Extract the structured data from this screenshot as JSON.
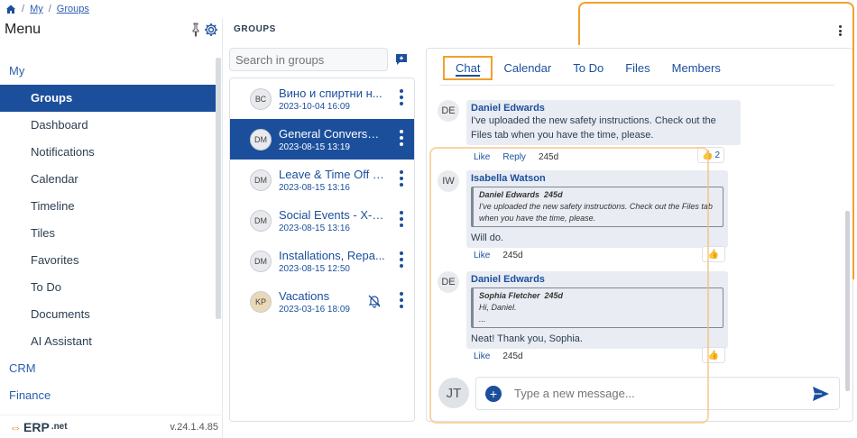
{
  "breadcrumb": {
    "items": [
      "My",
      "Groups"
    ]
  },
  "menu": {
    "title": "Menu",
    "sections": [
      {
        "label": "My"
      },
      {
        "label": "CRM"
      },
      {
        "label": "Finance"
      }
    ],
    "items": [
      {
        "label": "Groups"
      },
      {
        "label": "Dashboard"
      },
      {
        "label": "Notifications"
      },
      {
        "label": "Calendar"
      },
      {
        "label": "Timeline"
      },
      {
        "label": "Tiles"
      },
      {
        "label": "Favorites"
      },
      {
        "label": "To Do"
      },
      {
        "label": "Documents"
      },
      {
        "label": "AI Assistant"
      }
    ],
    "footer": {
      "logo_text": "ERP",
      "logo_suffix": ".net",
      "version": "v.24.1.4.85"
    }
  },
  "groups": {
    "title": "GROUPS",
    "search_placeholder": "Search in groups",
    "list": [
      {
        "name": "Вино и спиртни н...",
        "date": "2023-10-04 16:09",
        "avatar": "ВС"
      },
      {
        "name": "General Conversat...",
        "date": "2023-08-15 13:19",
        "avatar": "DM"
      },
      {
        "name": "Leave & Time Off - ...",
        "date": "2023-08-15 13:16",
        "avatar": "DM"
      },
      {
        "name": "Social Events - X-T...",
        "date": "2023-08-15 13:16",
        "avatar": "DM"
      },
      {
        "name": "Installations, Repa...",
        "date": "2023-08-15 12:50",
        "avatar": "DM"
      },
      {
        "name": "Vacations",
        "date": "2023-03-16 18:09",
        "avatar": "KP"
      }
    ]
  },
  "chat": {
    "tabs": [
      "Chat",
      "Calendar",
      "To Do",
      "Files",
      "Members"
    ],
    "messages": [
      {
        "initials": "DE",
        "author": "Daniel Edwards",
        "text_line1": "I've uploaded the new safety instructions. Check out the",
        "text_line2": "Files tab when you have the time, please.",
        "like": "Like",
        "reply": "Reply",
        "ago": "245d",
        "likes": "2"
      },
      {
        "initials": "IW",
        "author": "Isabella Watson",
        "quote_author": "Daniel Edwards",
        "quote_ago": "245d",
        "quote_line1": "I've uploaded the new safety instructions. Check out the Files tab",
        "quote_line2": "when you have the time, please.",
        "text": "Will do.",
        "like": "Like",
        "ago": "245d"
      },
      {
        "initials": "DE",
        "author": "Daniel Edwards",
        "quote_author": "Sophia Fletcher",
        "quote_ago": "245d",
        "quote_line1": "Hi, Daniel.",
        "quote_line2": "...",
        "text": "Neat! Thank you, Sophia.",
        "like": "Like",
        "ago": "245d"
      }
    ],
    "composer": {
      "avatar": "JT",
      "placeholder": "Type a new message..."
    }
  },
  "colors": {
    "accent": "#1b4f9c",
    "highlight": "#f2a02d"
  }
}
